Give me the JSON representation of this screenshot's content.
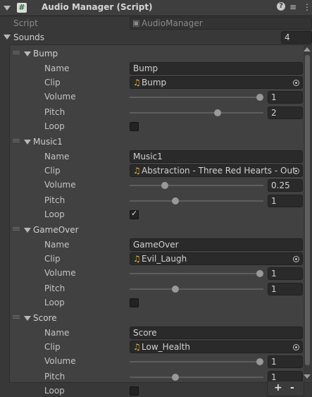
{
  "header": {
    "title": "Audio Manager (Script)"
  },
  "script_field": {
    "label": "Script",
    "value": "AudioManager"
  },
  "sounds": {
    "label": "Sounds",
    "count": "4"
  },
  "field_labels": {
    "name": "Name",
    "clip": "Clip",
    "volume": "Volume",
    "pitch": "Pitch",
    "loop": "Loop"
  },
  "elements": [
    {
      "title": "Bump",
      "name": "Bump",
      "clip": "Bump",
      "volume": "1",
      "volume_fraction": 1.0,
      "pitch": "2",
      "pitch_fraction": 0.667,
      "loop": false
    },
    {
      "title": "Music1",
      "name": "Music1",
      "clip": "Abstraction - Three Red Hearts - Out",
      "volume": "0.25",
      "volume_fraction": 0.25,
      "pitch": "1",
      "pitch_fraction": 0.333,
      "loop": true
    },
    {
      "title": "GameOver",
      "name": "GameOver",
      "clip": "Evil_Laugh",
      "volume": "1",
      "volume_fraction": 1.0,
      "pitch": "1",
      "pitch_fraction": 0.333,
      "loop": false
    },
    {
      "title": "Score",
      "name": "Score",
      "clip": "Low_Health",
      "volume": "1",
      "volume_fraction": 1.0,
      "pitch": "1",
      "pitch_fraction": 0.333,
      "loop": false
    }
  ],
  "footer": {
    "add_label": "+",
    "remove_label": "-"
  },
  "icons": {
    "help": "help-icon",
    "settings": "sliders-icon",
    "menu": "kebab-menu-icon",
    "clip": "audio-clip-icon",
    "picker": "object-picker-icon",
    "reorder": "reorder-handle-icon"
  }
}
